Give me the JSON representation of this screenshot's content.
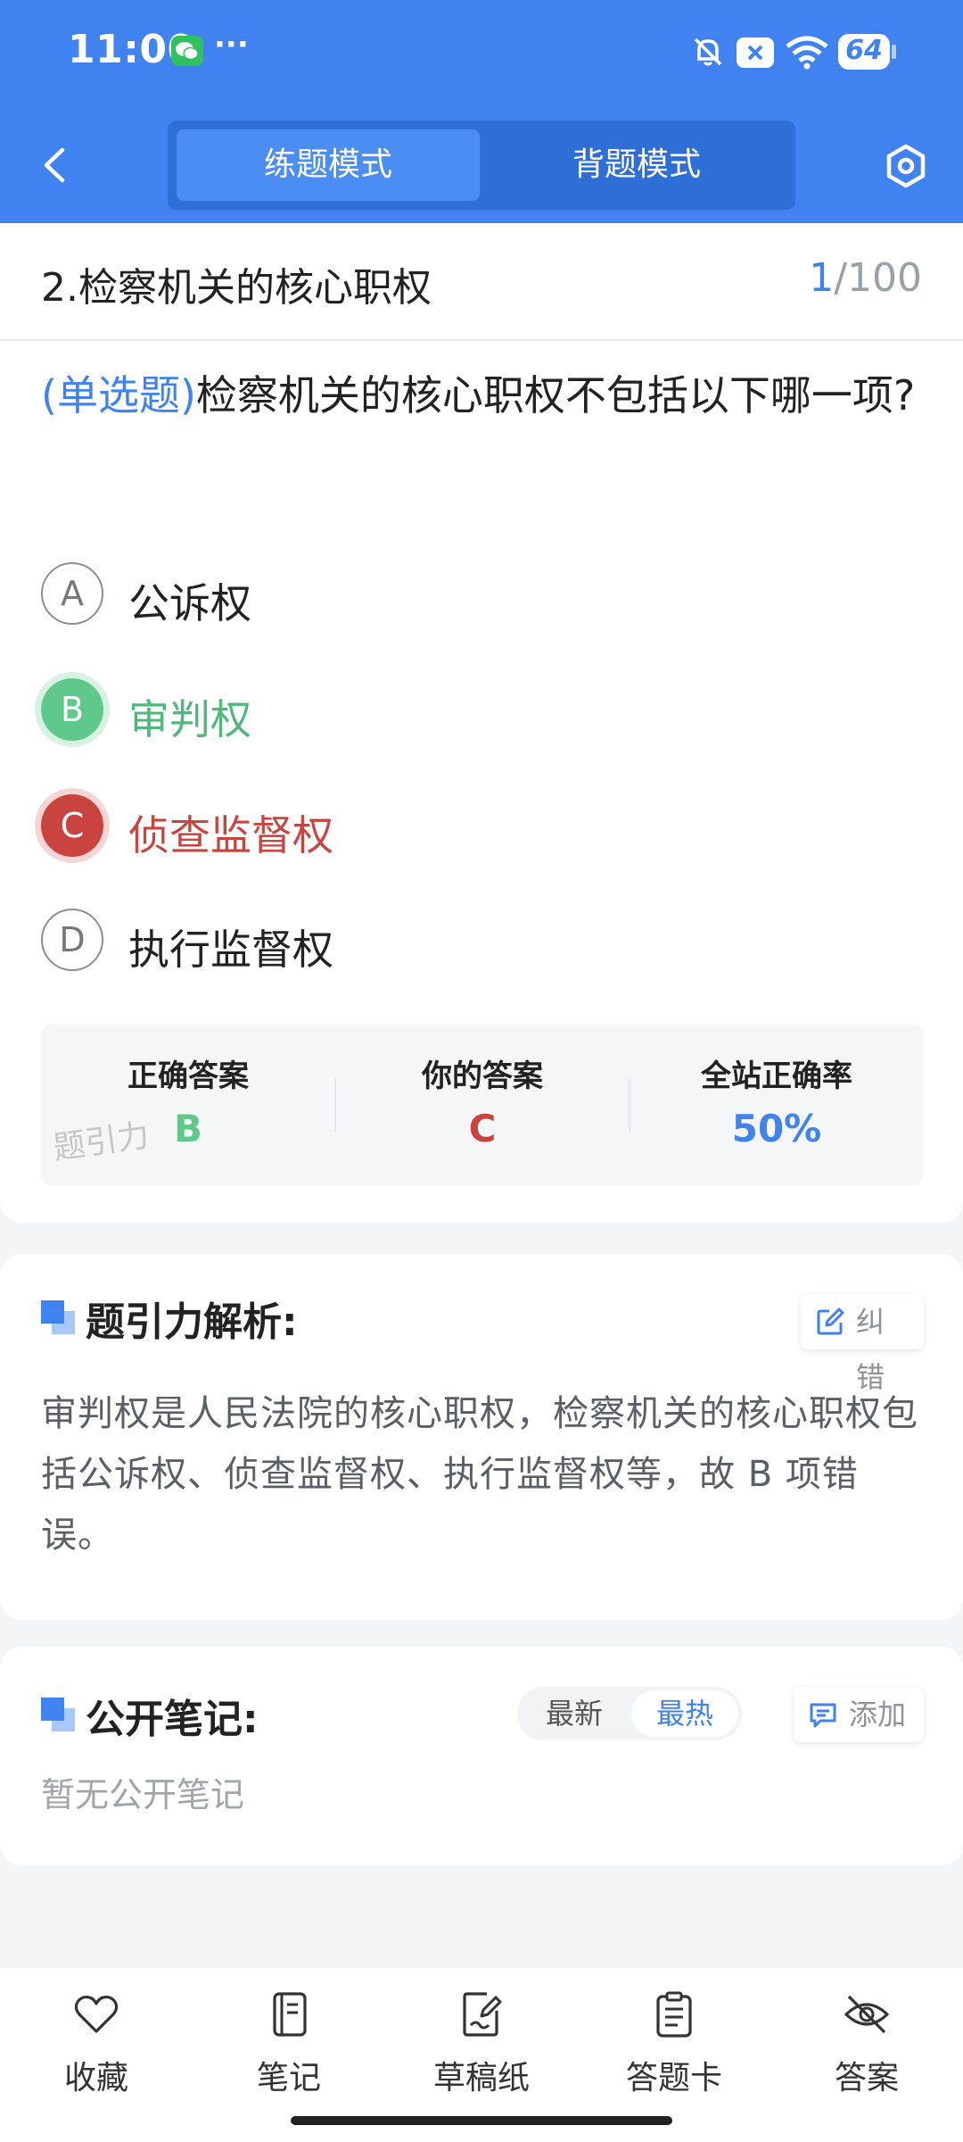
{
  "status_bar": {
    "time": "11:00",
    "battery": "64",
    "battery_level": 0.64
  },
  "nav": {
    "tab_practice": "练题模式",
    "tab_recite": "背题模式"
  },
  "question": {
    "title": "2.检察机关的核心职权",
    "current": "1",
    "total": "/100",
    "type_label": "(单选题)",
    "text": "检察机关的核心职权不包括以下哪一项?",
    "options": [
      {
        "letter": "A",
        "text": "公诉权",
        "state": "default"
      },
      {
        "letter": "B",
        "text": "审判权",
        "state": "correct"
      },
      {
        "letter": "C",
        "text": "侦查监督权",
        "state": "wrong"
      },
      {
        "letter": "D",
        "text": "执行监督权",
        "state": "default"
      }
    ]
  },
  "answer_panel": {
    "correct_label": "正确答案",
    "correct_value": "B",
    "yours_label": "你的答案",
    "yours_value": "C",
    "rate_label": "全站正确率",
    "rate_value": "50%",
    "watermark": "题引力"
  },
  "analysis": {
    "title": "题引力解析:",
    "report_label": "纠错",
    "text": "审判权是人民法院的核心职权，检察机关的核心职权包括公诉权、侦查监督权、执行监督权等，故 B 项错误。"
  },
  "notes": {
    "title": "公开笔记:",
    "sort_latest": "最新",
    "sort_hot": "最热",
    "add_label": "添加",
    "empty": "暂无公开笔记"
  },
  "bottom_tabs": [
    {
      "label": "收藏",
      "icon": "heart-icon"
    },
    {
      "label": "笔记",
      "icon": "notebook-icon"
    },
    {
      "label": "草稿纸",
      "icon": "draft-icon"
    },
    {
      "label": "答题卡",
      "icon": "answer-sheet-icon"
    },
    {
      "label": "答案",
      "icon": "eye-off-icon"
    }
  ],
  "colors": {
    "primary": "#3f82f0",
    "correct": "#5ec98a",
    "wrong": "#c9443f"
  }
}
